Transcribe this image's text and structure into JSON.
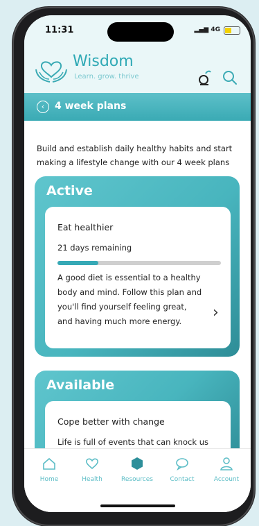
{
  "status": {
    "time": "11:31",
    "signal": "4G"
  },
  "brand": {
    "name": "Wisdom",
    "tagline": "Learn. grow. thrive"
  },
  "banner": {
    "title": "4 week plans"
  },
  "intro": "Build and establish daily healthy habits and start making a lifestyle change with our 4 week plans",
  "active": {
    "heading": "Active",
    "plan_title": "Eat healthier",
    "remaining": "21 days remaining",
    "progress": 0.25,
    "description": "A good diet is essential to a healthy body and mind. Follow this plan and you'll find yourself feeling great, and having much more energy."
  },
  "available": {
    "heading": "Available",
    "plan_title": "Cope better with change",
    "description": "Life is full of events that can knock us"
  },
  "tabs": [
    {
      "label": "Home",
      "icon": "home-icon"
    },
    {
      "label": "Health",
      "icon": "heart-icon"
    },
    {
      "label": "Resources",
      "icon": "resources-icon"
    },
    {
      "label": "Contact",
      "icon": "chat-icon"
    },
    {
      "label": "Account",
      "icon": "user-icon"
    }
  ],
  "colors": {
    "accent": "#3aaab4",
    "background": "#dceef2"
  }
}
